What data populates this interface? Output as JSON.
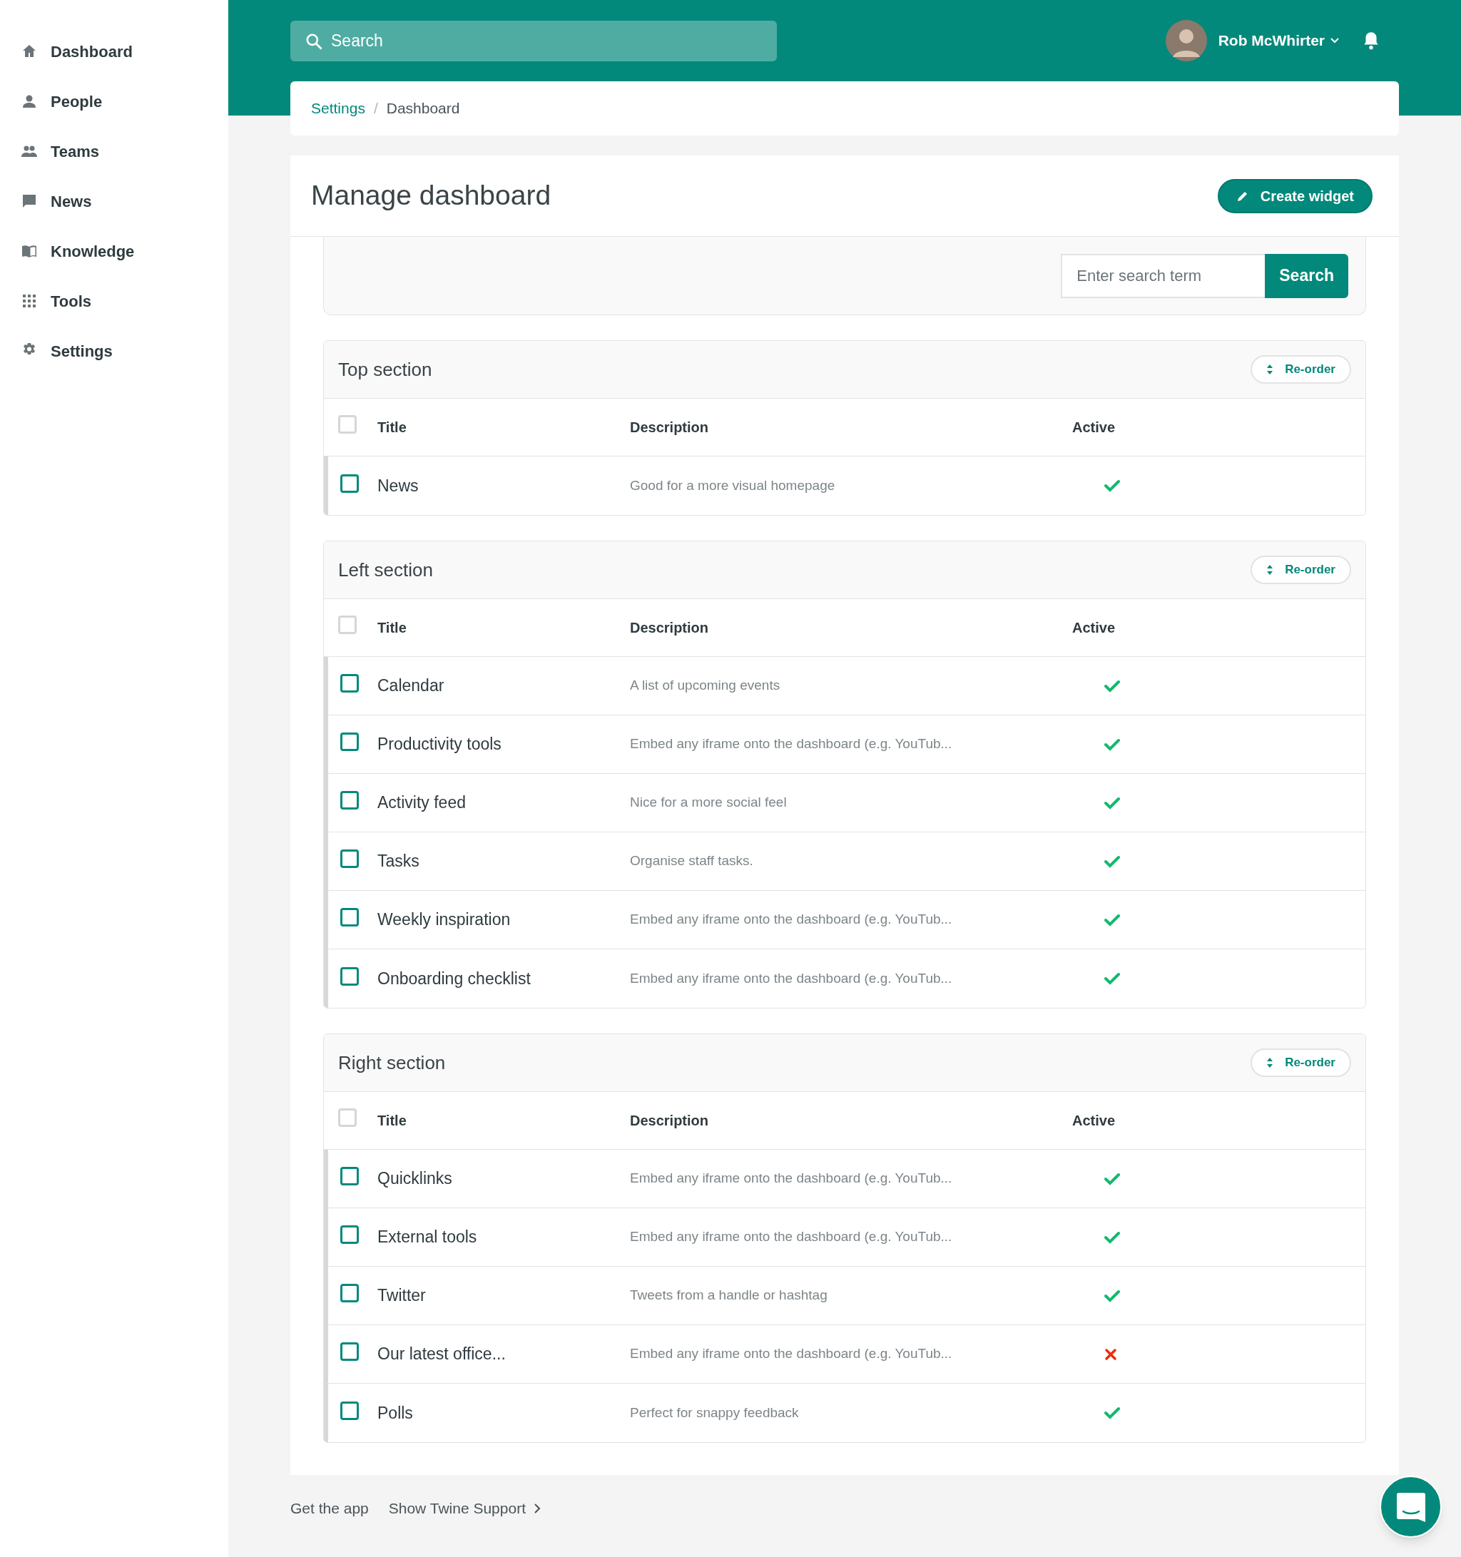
{
  "sidebar": {
    "items": [
      {
        "label": "Dashboard"
      },
      {
        "label": "People"
      },
      {
        "label": "Teams"
      },
      {
        "label": "News"
      },
      {
        "label": "Knowledge"
      },
      {
        "label": "Tools"
      },
      {
        "label": "Settings"
      }
    ]
  },
  "header": {
    "search": {
      "placeholder": "Search"
    },
    "user": {
      "name": "Rob McWhirter"
    }
  },
  "breadcrumb": [
    {
      "label": "Settings",
      "link": true
    },
    {
      "label": "/",
      "link": false
    },
    {
      "label": "Dashboard",
      "link": false
    }
  ],
  "page": {
    "title": "Manage dashboard",
    "create_button": "Create widget",
    "filter": {
      "placeholder": "Enter search term",
      "button": "Search"
    }
  },
  "sections": [
    {
      "title": "Top section",
      "reorder": "Re-order",
      "columns": [
        "Title",
        "Description",
        "Active"
      ],
      "all_checked": false,
      "rows": [
        {
          "title": "News",
          "description": "Good for a more visual homepage",
          "active": true,
          "checked": false
        }
      ]
    },
    {
      "title": "Left section",
      "reorder": "Re-order",
      "columns": [
        "Title",
        "Description",
        "Active"
      ],
      "all_checked": false,
      "rows": [
        {
          "title": "Calendar",
          "description": "A list of upcoming events",
          "active": true,
          "checked": false
        },
        {
          "title": "Productivity tools",
          "description": "Embed any iframe onto the dashboard (e.g. YouTub...",
          "active": true,
          "checked": false
        },
        {
          "title": "Activity feed",
          "description": "Nice for a more social feel",
          "active": true,
          "checked": false
        },
        {
          "title": "Tasks",
          "description": "Organise staff tasks.",
          "active": true,
          "checked": false
        },
        {
          "title": "Weekly inspiration",
          "description": "Embed any iframe onto the dashboard (e.g. YouTub...",
          "active": true,
          "checked": false
        },
        {
          "title": "Onboarding checklist",
          "description": "Embed any iframe onto the dashboard (e.g. YouTub...",
          "active": true,
          "checked": false
        }
      ]
    },
    {
      "title": "Right section",
      "reorder": "Re-order",
      "columns": [
        "Title",
        "Description",
        "Active"
      ],
      "all_checked": false,
      "rows": [
        {
          "title": "Quicklinks",
          "description": "Embed any iframe onto the dashboard (e.g. YouTub...",
          "active": true,
          "checked": false
        },
        {
          "title": "External tools",
          "description": "Embed any iframe onto the dashboard (e.g. YouTub...",
          "active": true,
          "checked": false
        },
        {
          "title": "Twitter",
          "description": "Tweets from a handle or hashtag",
          "active": true,
          "checked": false
        },
        {
          "title": "Our latest office...",
          "description": "Embed any iframe onto the dashboard (e.g. YouTub...",
          "active": false,
          "checked": false
        },
        {
          "title": "Polls",
          "description": "Perfect for snappy feedback",
          "active": true,
          "checked": false
        }
      ]
    }
  ],
  "footer": {
    "links": [
      "Get the app",
      "Show Twine Support"
    ]
  }
}
